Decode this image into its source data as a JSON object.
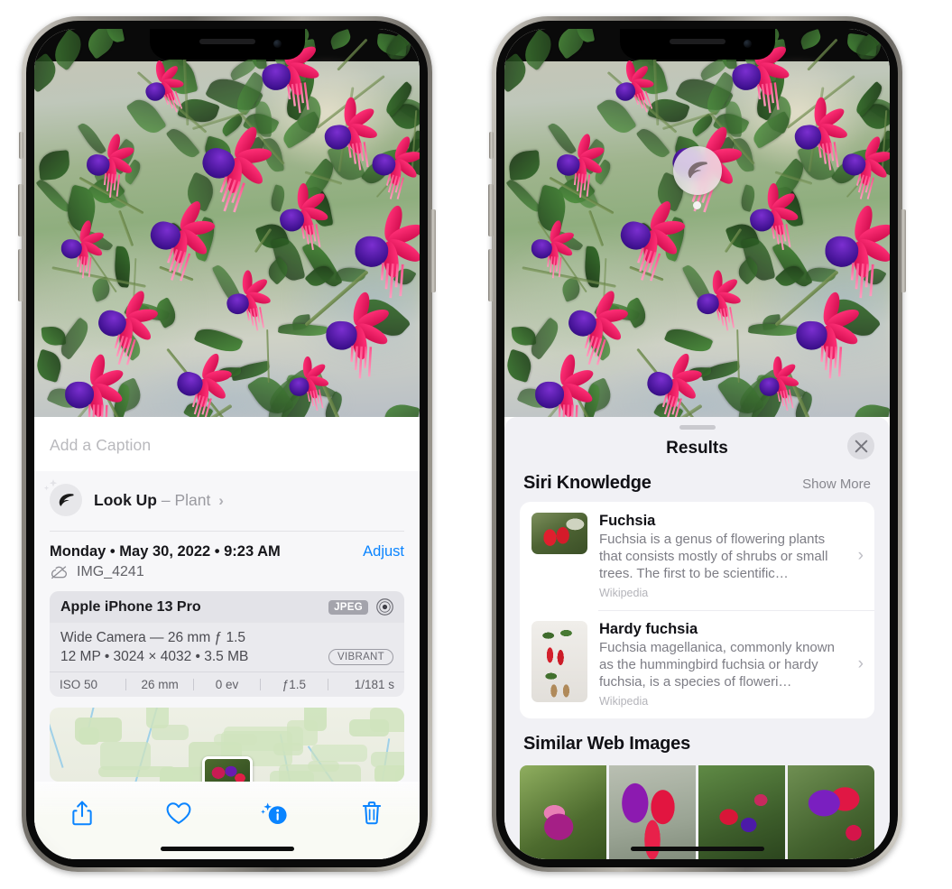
{
  "left_phone": {
    "name": "photos-detail-view",
    "caption": {
      "placeholder": "Add a Caption",
      "value": ""
    },
    "lookup": {
      "label": "Look Up",
      "dash": "–",
      "subject": "Plant",
      "chevron": "›",
      "icon": "leaf-icon"
    },
    "date_row": {
      "date": "Monday • May 30, 2022 • 9:23 AM",
      "adjust_label": "Adjust"
    },
    "file_row": {
      "icon": "cloud-slash-icon",
      "filename": "IMG_4241"
    },
    "exif": {
      "device": "Apple iPhone 13 Pro",
      "format_badge": "JPEG",
      "lens_icon": "aperture-icon",
      "lens_line": "Wide Camera — 26 mm ƒ 1.5",
      "specs_line": "12 MP • 3024 × 4032 • 3.5 MB",
      "style_badge": "VIBRANT",
      "settings": [
        "ISO 50",
        "26 mm",
        "0 ev",
        "ƒ1.5",
        "1/181 s"
      ]
    },
    "toolbar": [
      {
        "name": "share-button",
        "icon": "share-icon"
      },
      {
        "name": "favorite-button",
        "icon": "heart-icon"
      },
      {
        "name": "info-button",
        "icon": "info-sparkle-icon"
      },
      {
        "name": "delete-button",
        "icon": "trash-icon"
      }
    ]
  },
  "right_phone": {
    "name": "visual-lookup-results-view",
    "badge": {
      "icon": "leaf-icon"
    },
    "sheet": {
      "title": "Results",
      "close_icon": "close-icon",
      "siri_knowledge": {
        "title": "Siri Knowledge",
        "show_more": "Show More",
        "items": [
          {
            "title": "Fuchsia",
            "description": "Fuchsia is a genus of flowering plants that consists mostly of shrubs or small trees. The first to be scientific…",
            "source": "Wikipedia",
            "chevron": "›"
          },
          {
            "title": "Hardy fuchsia",
            "description": "Fuchsia magellanica, commonly known as the hummingbird fuchsia or hardy fuchsia, is a species of floweri…",
            "source": "Wikipedia",
            "chevron": "›"
          }
        ]
      },
      "similar_web_images": {
        "title": "Similar Web Images",
        "count": 4
      }
    }
  },
  "colors": {
    "accent_blue": "#0a84ff",
    "sheet_bg": "#f1f1f5",
    "card_bg": "#ffffff",
    "panel_bg": "#f7f7f9",
    "exif_bg": "#eaeaee",
    "text_primary": "#111116",
    "text_secondary": "#7d7d85",
    "text_tertiary": "#b4b4ba"
  }
}
